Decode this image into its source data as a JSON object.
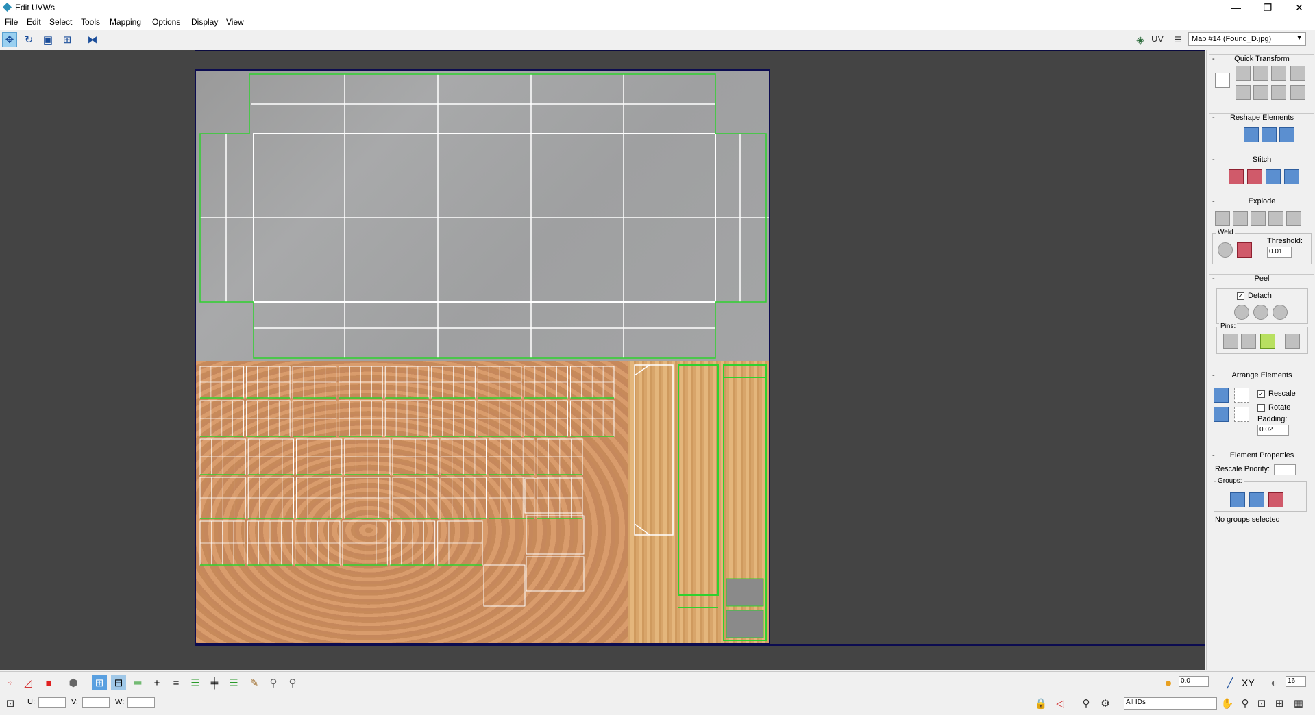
{
  "window": {
    "title": "Edit UVWs",
    "controls": {
      "minimize": "—",
      "maximize": "❐",
      "close": "✕"
    }
  },
  "menu": [
    "File",
    "Edit",
    "Select",
    "Tools",
    "Mapping",
    "Options",
    "Display",
    "View"
  ],
  "toolbar": {
    "tools": [
      {
        "name": "move-tool",
        "icon": "✥",
        "active": true
      },
      {
        "name": "rotate-tool",
        "icon": "↻",
        "active": false
      },
      {
        "name": "scale-tool",
        "icon": "▣",
        "active": false
      },
      {
        "name": "freeform-tool",
        "icon": "⊞",
        "active": false
      },
      {
        "name": "mirror-tool",
        "icon": "⧓",
        "active": false
      }
    ],
    "uv_label": "UV",
    "map_select": "Map #14 (Found_D.jpg)"
  },
  "panel": {
    "quick_transform": {
      "title": "Quick Transform"
    },
    "reshape": {
      "title": "Reshape Elements"
    },
    "stitch": {
      "title": "Stitch"
    },
    "explode": {
      "title": "Explode",
      "weld_label": "Weld",
      "threshold_label": "Threshold:",
      "threshold_value": "0.01"
    },
    "peel": {
      "title": "Peel",
      "detach_label": "Detach",
      "pins_label": "Pins:"
    },
    "arrange": {
      "title": "Arrange Elements",
      "rescale_label": "Rescale",
      "rotate_label": "Rotate",
      "padding_label": "Padding:",
      "padding_value": "0.02"
    },
    "element_props": {
      "title": "Element Properties",
      "rescale_priority_label": "Rescale Priority:",
      "groups_label": "Groups:",
      "status": "No groups selected"
    }
  },
  "bottom": {
    "soft_value": "0.0",
    "xy_label": "XY",
    "zoom_value": "16",
    "u_label": "U:",
    "v_label": "V:",
    "w_label": "W:",
    "ids_select": "All IDs"
  },
  "colors": {
    "viewport_bg": "#444444",
    "uv_selected": "#2fd12f",
    "uv_edges": "#ffffff",
    "texture_border": "#0c0c50"
  }
}
